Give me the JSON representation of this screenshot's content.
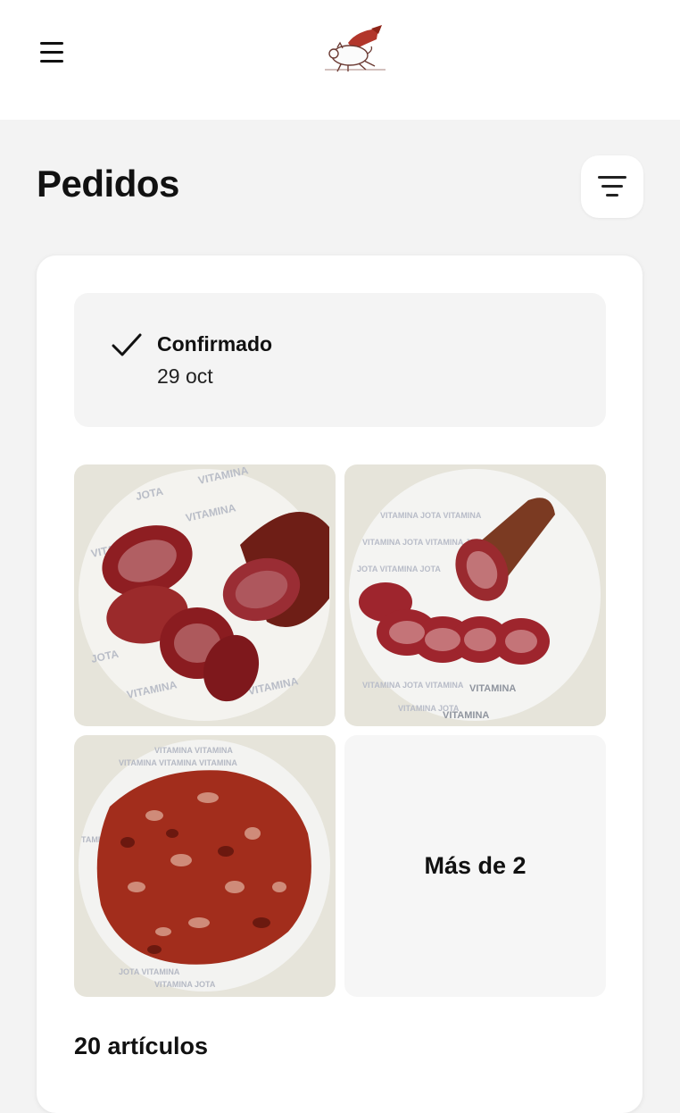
{
  "header": {
    "menu_icon": "hamburger-menu-icon",
    "logo_icon": "flying-pig-logo-icon",
    "filter_icon": "filter-lines-icon"
  },
  "page": {
    "title": "Pedidos"
  },
  "order": {
    "status": {
      "icon": "checkmark-icon",
      "label": "Confirmado",
      "date": "29 oct"
    },
    "products": [
      {
        "name": "lomo-slices-photo",
        "wrapper_text": "VITAMINA JOTA"
      },
      {
        "name": "chorizo-stick-photo",
        "wrapper_text": "VITAMINA JOTA"
      },
      {
        "name": "chorizo-slices-photo",
        "wrapper_text": "VITAMINA JOTA"
      }
    ],
    "more_label": "Más de 2",
    "items_count": "20 artículos"
  },
  "colors": {
    "background": "#f3f3f3",
    "card": "#ffffff",
    "status_box": "#f4f4f4",
    "photo_tile": "#e6e4da",
    "meat_red": "#8e1e22",
    "chorizo_red": "#a22d1c",
    "logo_red": "#b2362b"
  }
}
